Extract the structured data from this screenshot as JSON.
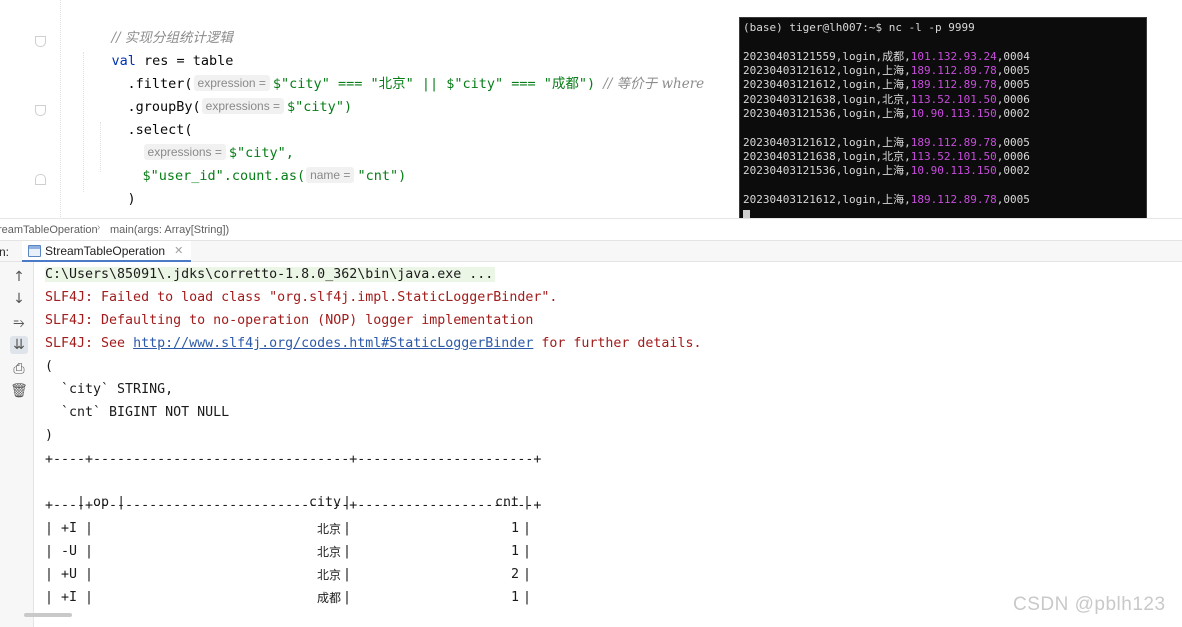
{
  "editor": {
    "comment": "// 实现分组统计逻辑",
    "line_val": {
      "keyword": "val",
      "rest": " res = table"
    },
    "line_filter": {
      "method": ".filter(",
      "hint": "expression =",
      "arg": "$\"city\" === \"北京\" || $\"city\" === \"成都\")",
      "comment": "// 等价于 where"
    },
    "line_groupby": {
      "method": ".groupBy(",
      "hint": "expressions =",
      "arg": "$\"city\")"
    },
    "line_select": {
      "method": ".select("
    },
    "line_select_arg1": {
      "hint": "expressions =",
      "arg": "$\"city\","
    },
    "line_select_arg2": {
      "arg_start": "$\"user_id\".count.as(",
      "hint": "name =",
      "arg_end": "\"cnt\")"
    },
    "line_close": ")"
  },
  "terminal": {
    "prompt": "(base) tiger@lh007:~$ nc -l -p 9999",
    "lines": [
      {
        "prefix": "20230403121559,login,成都,",
        "ip": "101.132.93.24",
        "suffix": ",0004"
      },
      {
        "prefix": "20230403121612,login,上海,",
        "ip": "189.112.89.78",
        "suffix": ",0005"
      },
      {
        "prefix": "20230403121612,login,上海,",
        "ip": "189.112.89.78",
        "suffix": ",0005"
      },
      {
        "prefix": "20230403121638,login,北京,",
        "ip": "113.52.101.50",
        "suffix": ",0006"
      },
      {
        "prefix": "20230403121536,login,上海,",
        "ip": "10.90.113.150",
        "suffix": ",0002"
      },
      {
        "prefix": "20230403121612,login,上海,",
        "ip": "189.112.89.78",
        "suffix": ",0005"
      },
      {
        "prefix": "20230403121638,login,北京,",
        "ip": "113.52.101.50",
        "suffix": ",0006"
      },
      {
        "prefix": "20230403121536,login,上海,",
        "ip": "10.90.113.150",
        "suffix": ",0002"
      },
      {
        "prefix": "20230403121612,login,上海,",
        "ip": "189.112.89.78",
        "suffix": ",0005"
      }
    ]
  },
  "breadcrumb": {
    "class_name": "reamTableOperation",
    "method": "main(args: Array[String])"
  },
  "run_panel": {
    "label": "n:",
    "tab_title": "StreamTableOperation"
  },
  "toolbar": {
    "icons": [
      "arrow-up-icon",
      "arrow-down-icon",
      "soft-wrap-icon",
      "scroll-to-end-icon",
      "print-icon",
      "trash-icon"
    ]
  },
  "console": {
    "command": "C:\\Users\\85091\\.jdks\\corretto-1.8.0_362\\bin\\java.exe ...",
    "slf4j_1": "SLF4J: Failed to load class \"org.slf4j.impl.StaticLoggerBinder\".",
    "slf4j_2": "SLF4J: Defaulting to no-operation (NOP) logger implementation",
    "slf4j_3_prefix": "SLF4J: See ",
    "slf4j_3_link": "http://www.slf4j.org/codes.html#StaticLoggerBinder",
    "slf4j_3_suffix": " for further details.",
    "schema_open": "(",
    "schema_city": "  `city` STRING,",
    "schema_cnt": "  `cnt` BIGINT NOT NULL",
    "schema_close": ")",
    "table_border": "+----+--------------------------------+----------------------+",
    "table_header": {
      "op": "op",
      "city": "city",
      "cnt": "cnt"
    },
    "rows": [
      {
        "op": "+I",
        "city": "北京",
        "cnt": "1"
      },
      {
        "op": "-U",
        "city": "北京",
        "cnt": "1"
      },
      {
        "op": "+U",
        "city": "北京",
        "cnt": "2"
      },
      {
        "op": "+I",
        "city": "成都",
        "cnt": "1"
      }
    ]
  },
  "watermark": "CSDN @pblh123"
}
